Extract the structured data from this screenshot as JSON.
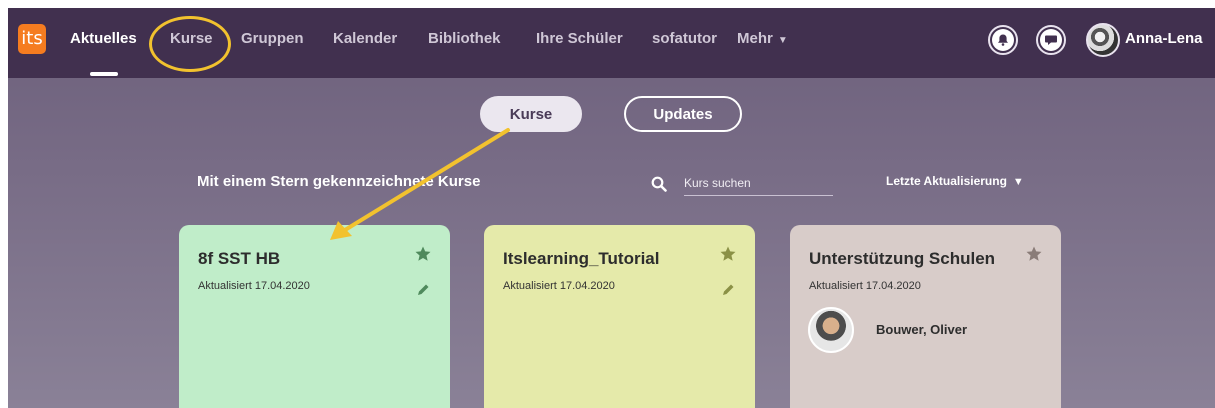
{
  "nav": {
    "logo_text": "its",
    "items": [
      {
        "label": "Aktuelles",
        "active": true
      },
      {
        "label": "Kurse",
        "highlighted": true
      },
      {
        "label": "Gruppen"
      },
      {
        "label": "Kalender"
      },
      {
        "label": "Bibliothek"
      },
      {
        "label": "Ihre Schüler"
      },
      {
        "label": "sofatutor"
      },
      {
        "label": "Mehr"
      }
    ],
    "user_name": "Anna-Lena",
    "icons": [
      "bell-icon",
      "chat-icon",
      "user-avatar"
    ]
  },
  "toggle": {
    "kurse_label": "Kurse",
    "updates_label": "Updates"
  },
  "section": {
    "title": "Mit einem Stern gekennzeichnete Kurse",
    "search_placeholder": "Kurs suchen",
    "sort_label": "Letzte Aktualisierung"
  },
  "cards": [
    {
      "title": "8f SST HB",
      "updated": "Aktualisiert 17.04.2020",
      "color": "#c0edc9",
      "star_color": "#4f8a5c"
    },
    {
      "title": "Itslearning_Tutorial",
      "updated": "Aktualisiert 17.04.2020",
      "color": "#e5eaaa",
      "star_color": "#8b9146"
    },
    {
      "title": "Unterstützung Schulen",
      "updated": "Aktualisiert 17.04.2020",
      "color": "#d8ccc9",
      "star_color": "#8a7c78",
      "teacher": "Bouwer, Oliver"
    }
  ],
  "colors": {
    "nav_bg": "#41304f",
    "accent_orange": "#f57c20",
    "annotation_yellow": "#f2c22e"
  }
}
